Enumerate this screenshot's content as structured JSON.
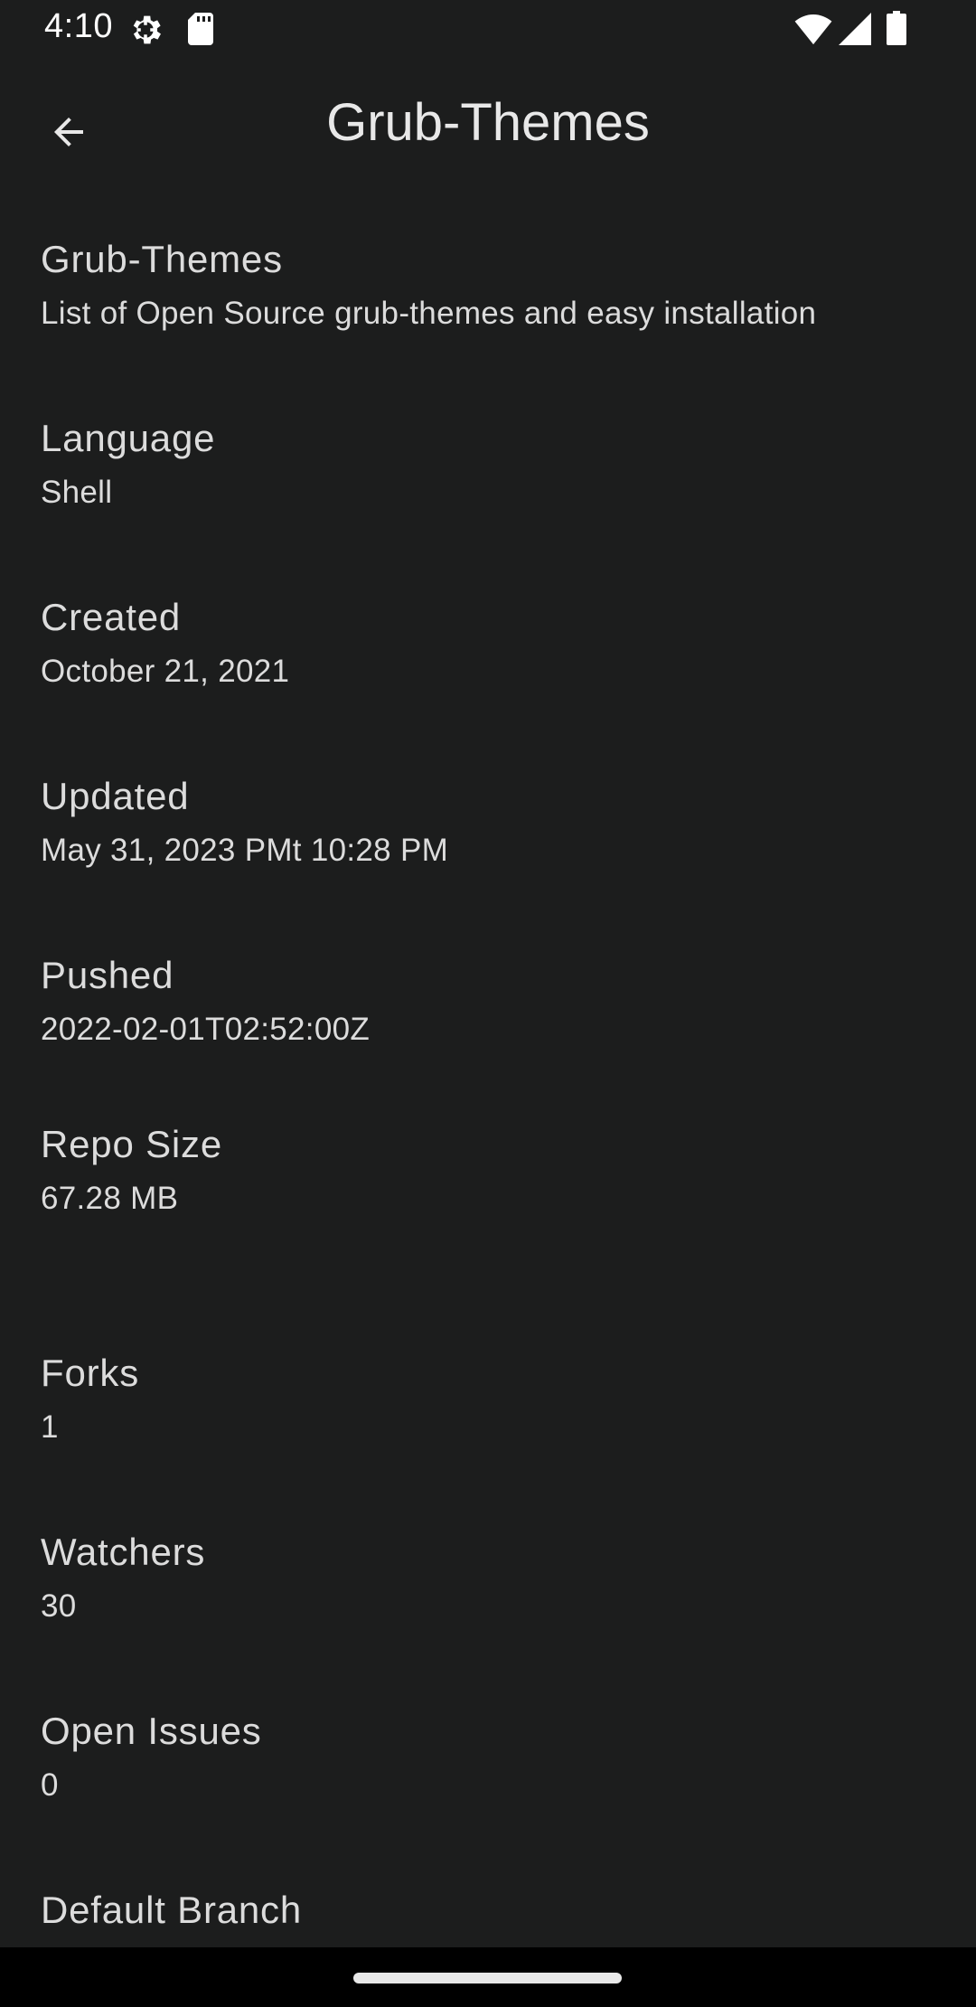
{
  "status_bar": {
    "time": "4:10",
    "icons": [
      "gear-icon",
      "sd-card-icon",
      "wifi-icon",
      "signal-icon",
      "battery-icon"
    ]
  },
  "app_bar": {
    "title": "Grub-Themes",
    "back_icon": "arrow-back-icon"
  },
  "details": {
    "name": {
      "label": "Grub-Themes",
      "value": "List of Open Source grub-themes and easy installation"
    },
    "language": {
      "label": "Language",
      "value": "Shell"
    },
    "created": {
      "label": "Created",
      "value": "October 21, 2021"
    },
    "updated": {
      "label": "Updated",
      "value": "May 31, 2023 PMt 10:28 PM"
    },
    "pushed": {
      "label": "Pushed",
      "value": "2022-02-01T02:52:00Z"
    },
    "repo_size": {
      "label": "Repo Size",
      "value": "67.28 MB"
    },
    "forks": {
      "label": "Forks",
      "value": "1"
    },
    "watchers": {
      "label": "Watchers",
      "value": "30"
    },
    "open_issues": {
      "label": "Open Issues",
      "value": "0"
    },
    "default_branch": {
      "label": "Default Branch"
    }
  },
  "colors": {
    "background": "#1c1d1d",
    "text": "#dcdcdc",
    "nav_bar": "#000000"
  }
}
